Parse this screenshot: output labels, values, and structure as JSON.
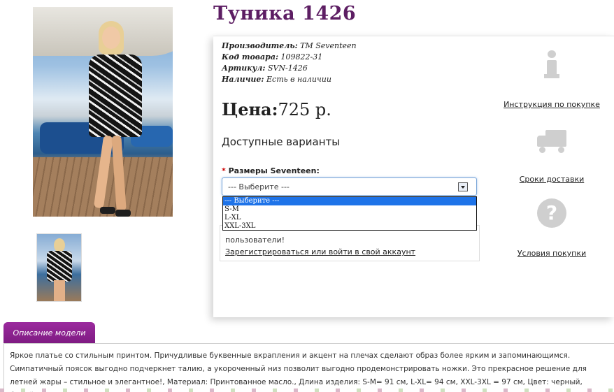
{
  "product": {
    "title": "Туника 1426",
    "meta": [
      {
        "label": "Производитель:",
        "value": "TM Seventeen"
      },
      {
        "label": "Код товара:",
        "value": "109822-31"
      },
      {
        "label": "Артикул:",
        "value": "SVN-1426"
      },
      {
        "label": "Наличие:",
        "value": "Есть в наличии"
      }
    ],
    "price_label": "Цена:",
    "price_value": "725 р.",
    "variants_heading": "Доступные варианты",
    "size_label": "Размеры Seventeen:",
    "size_required_mark": "*",
    "size_select": {
      "selected": "--- Выберите ---",
      "options": [
        "--- Выберите ---",
        "S-M",
        "L-XL",
        "XXL-3XL"
      ]
    },
    "login_message": "пользователи!",
    "login_link": "Зарегистрироваться или войти в свой аккаунт"
  },
  "side_links": [
    {
      "icon": "info-icon",
      "label": "Инструкция по покупке"
    },
    {
      "icon": "truck-icon",
      "label": "Сроки доставки"
    },
    {
      "icon": "question-icon",
      "label": "Условия покупки",
      "glyph": "?"
    }
  ],
  "description": {
    "tab_label": "Описание модели",
    "text": "Яркое платье со стильным принтом. Причудливые буквенные вкрапления и акцент на плечах сделают образ более ярким и запоминающимся. Симпатичный поясок выгодно подчеркнет талию, а укороченный низ позволит выгодно продемонстрировать ножки. Это прекрасное решение для летней жары – стильное и элегантное!, Материал: Принтованное масло., Длина изделия: S-M= 91 см, L-XL= 94 см, XXL-3XL = 97 см, Цвет: черный, белый."
  },
  "colors": {
    "title": "#5d1e63",
    "tab": "#8b228f",
    "dropdown_highlight": "#1e73e8"
  }
}
